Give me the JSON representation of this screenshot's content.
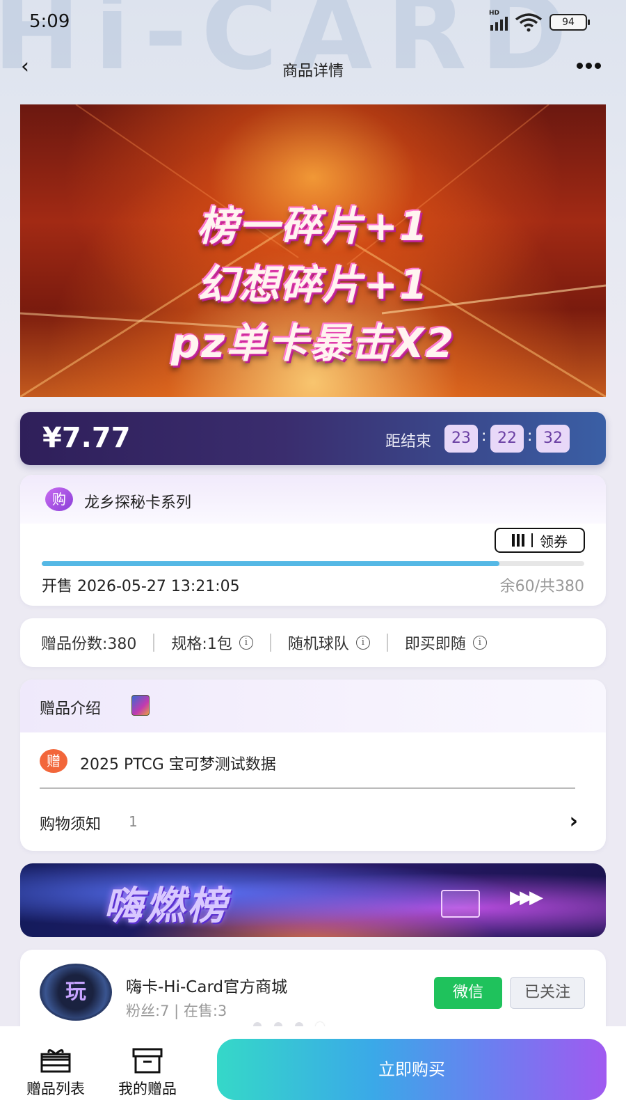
{
  "status_bar": {
    "time": "5:09",
    "network": "HD",
    "battery": "94"
  },
  "header": {
    "title": "商品详情",
    "back_icon": "chevron-left-icon",
    "more_icon": "more-dots-icon"
  },
  "background_watermark": "Hi-CARD",
  "banner": {
    "lines": [
      "榜一碎片+1",
      "幻想碎片+1",
      "pz单卡暴击X2"
    ]
  },
  "price_bar": {
    "price": "¥7.77",
    "countdown_label": "距结束",
    "countdown": {
      "hours": "23",
      "minutes": "22",
      "seconds": "32"
    }
  },
  "product": {
    "badge": "购",
    "series": "龙乡探秘卡系列",
    "coupon_label": "领券",
    "progress_fraction": 0.843,
    "sale_time": "开售 2026-05-27 13:21:05",
    "stock": "余60/共380"
  },
  "specs": {
    "items": [
      {
        "label": "赠品份数:380",
        "has_info": false
      },
      {
        "label": "规格:1包",
        "has_info": true
      },
      {
        "label": "随机球队",
        "has_info": true
      },
      {
        "label": "即买即随",
        "has_info": true
      }
    ]
  },
  "gift_intro": {
    "title": "赠品介绍",
    "badge": "赠",
    "name": "2025 PTCG 宝可梦测试数据",
    "notice_label": "购物须知",
    "notice_count": "1"
  },
  "promo": {
    "title": "嗨燃榜",
    "arrows": "▶▶▶"
  },
  "shop": {
    "avatar_text": "玩",
    "name": "嗨卡-Hi-Card官方商城",
    "stats": "粉丝:7 | 在售:3",
    "wechat_label": "微信",
    "follow_label": "已关注"
  },
  "bottom_bar": {
    "tabs": [
      {
        "label": "赠品列表",
        "icon": "gift-box-icon"
      },
      {
        "label": "我的赠品",
        "icon": "archive-box-icon"
      }
    ],
    "buy_label": "立即购买"
  },
  "colors": {
    "accent_purple": "#8a3fd8",
    "progress": "#55b8e5",
    "wechat_green": "#1fc25c",
    "gift_orange": "#f2663a"
  }
}
